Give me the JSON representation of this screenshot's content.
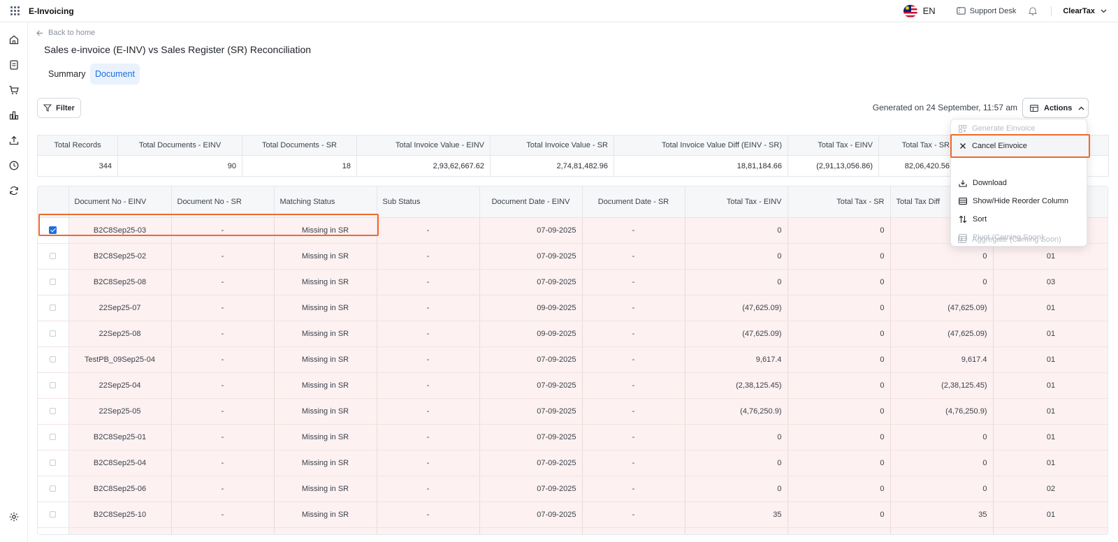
{
  "app": {
    "title": "E-Invoicing"
  },
  "topbar": {
    "language": "EN",
    "support_label": "Support Desk",
    "org_name": "ClearTax"
  },
  "nav": {
    "back_label": "Back to home"
  },
  "page": {
    "title": "Sales e-invoice (E-INV) vs Sales Register (SR) Reconciliation"
  },
  "tabs": [
    {
      "label": "Summary",
      "active": false
    },
    {
      "label": "Document",
      "active": true
    }
  ],
  "toolbar": {
    "filter_label": "Filter",
    "generated_text": "Generated on 24 September, 11:57 am",
    "actions_label": "Actions"
  },
  "actions_menu": {
    "items": [
      {
        "label": "Generate Einvoice",
        "icon": "generate-icon",
        "disabled": true
      },
      {
        "label": "Cancel Einvoice",
        "icon": "close-icon",
        "disabled": false,
        "highlighted": true
      },
      {
        "label": "Download",
        "icon": "download-icon",
        "disabled": false
      },
      {
        "label": "Show/Hide Reorder Column",
        "icon": "columns-icon",
        "disabled": false
      },
      {
        "label": "Sort",
        "icon": "sort-icon",
        "disabled": false
      },
      {
        "label": "Pivot (Coming Soon)",
        "icon": "pivot-icon",
        "disabled": true
      },
      {
        "label": "Aggregate (Coming Soon)",
        "icon": "aggregate-icon",
        "disabled": true
      }
    ]
  },
  "summary": {
    "headers": [
      "Total Records",
      "Total Documents - EINV",
      "Total Documents - SR",
      "Total Invoice Value - EINV",
      "Total Invoice Value - SR",
      "Total Invoice Value Diff (EINV - SR)",
      "Total Tax - EINV",
      "Total Tax - SR",
      ""
    ],
    "values": [
      "344",
      "90",
      "18",
      "2,93,62,667.62",
      "2,74,81,482.96",
      "18,81,184.66",
      "(2,91,13,056.86)",
      "82,06,420.56",
      ""
    ]
  },
  "grid": {
    "headers": [
      "",
      "Document No - EINV",
      "Document No - SR",
      "Matching Status",
      "Sub Status",
      "Document Date - EINV",
      "Document Date - SR",
      "Total Tax - EINV",
      "Total Tax - SR",
      "Total Tax Diff",
      ""
    ],
    "rows": [
      {
        "checked": true,
        "cells": [
          "B2C8Sep25-03",
          "-",
          "Missing in SR",
          "-",
          "07-09-2025",
          "-",
          "0",
          "0",
          "",
          ""
        ]
      },
      {
        "checked": false,
        "cells": [
          "B2C8Sep25-02",
          "-",
          "Missing in SR",
          "-",
          "07-09-2025",
          "-",
          "0",
          "0",
          "0",
          "01"
        ]
      },
      {
        "checked": false,
        "cells": [
          "B2C8Sep25-08",
          "-",
          "Missing in SR",
          "-",
          "07-09-2025",
          "-",
          "0",
          "0",
          "0",
          "03"
        ]
      },
      {
        "checked": false,
        "cells": [
          "22Sep25-07",
          "-",
          "Missing in SR",
          "-",
          "09-09-2025",
          "-",
          "(47,625.09)",
          "0",
          "(47,625.09)",
          "01"
        ]
      },
      {
        "checked": false,
        "cells": [
          "22Sep25-08",
          "-",
          "Missing in SR",
          "-",
          "09-09-2025",
          "-",
          "(47,625.09)",
          "0",
          "(47,625.09)",
          "01"
        ]
      },
      {
        "checked": false,
        "cells": [
          "TestPB_09Sep25-04",
          "-",
          "Missing in SR",
          "-",
          "07-09-2025",
          "-",
          "9,617.4",
          "0",
          "9,617.4",
          "01"
        ]
      },
      {
        "checked": false,
        "cells": [
          "22Sep25-04",
          "-",
          "Missing in SR",
          "-",
          "07-09-2025",
          "-",
          "(2,38,125.45)",
          "0",
          "(2,38,125.45)",
          "01"
        ]
      },
      {
        "checked": false,
        "cells": [
          "22Sep25-05",
          "-",
          "Missing in SR",
          "-",
          "07-09-2025",
          "-",
          "(4,76,250.9)",
          "0",
          "(4,76,250.9)",
          "01"
        ]
      },
      {
        "checked": false,
        "cells": [
          "B2C8Sep25-01",
          "-",
          "Missing in SR",
          "-",
          "07-09-2025",
          "-",
          "0",
          "0",
          "0",
          "01"
        ]
      },
      {
        "checked": false,
        "cells": [
          "B2C8Sep25-04",
          "-",
          "Missing in SR",
          "-",
          "07-09-2025",
          "-",
          "0",
          "0",
          "0",
          "01"
        ]
      },
      {
        "checked": false,
        "cells": [
          "B2C8Sep25-06",
          "-",
          "Missing in SR",
          "-",
          "07-09-2025",
          "-",
          "0",
          "0",
          "0",
          "02"
        ]
      },
      {
        "checked": false,
        "cells": [
          "B2C8Sep25-10",
          "-",
          "Missing in SR",
          "-",
          "07-09-2025",
          "-",
          "35",
          "0",
          "35",
          "01"
        ]
      },
      {
        "checked": false,
        "cells": [
          "",
          "",
          "",
          "",
          "",
          "",
          "",
          "",
          "",
          ""
        ]
      }
    ]
  },
  "colors": {
    "accent": "#1f6fe0",
    "highlight": "#ef6a2c",
    "row_bg": "#fdf1f1"
  }
}
